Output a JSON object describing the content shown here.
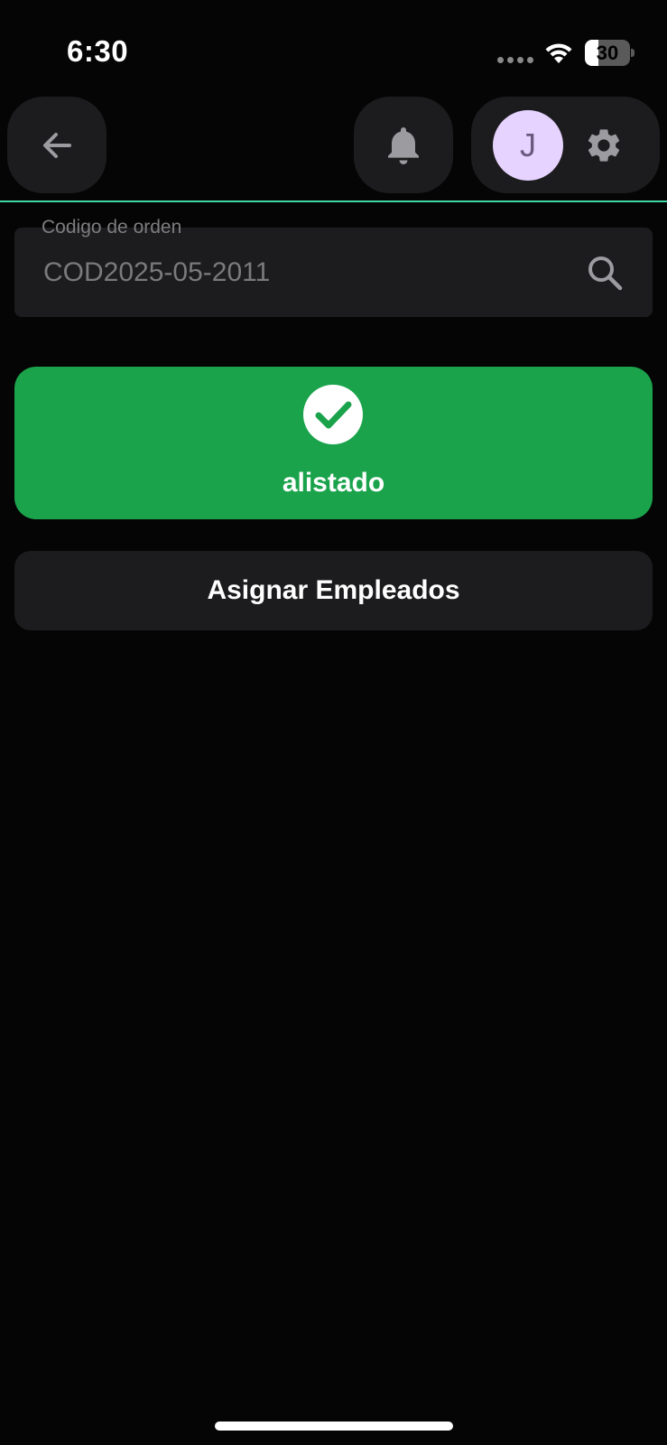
{
  "status_bar": {
    "time": "6:30",
    "battery_level": "30",
    "battery_fraction": 0.3
  },
  "header": {
    "back_icon": "arrow-left-icon",
    "notifications_icon": "bell-icon",
    "avatar_initial": "J",
    "settings_icon": "gear-icon",
    "divider_color": "#3fd6a4"
  },
  "search": {
    "label": "Codigo de orden",
    "value": "COD2025-05-2011",
    "icon": "search-icon"
  },
  "status_card": {
    "label": "alistado",
    "icon": "check-circle-icon",
    "color": "#1ba34c"
  },
  "actions": {
    "assign_label": "Asignar Empleados"
  }
}
